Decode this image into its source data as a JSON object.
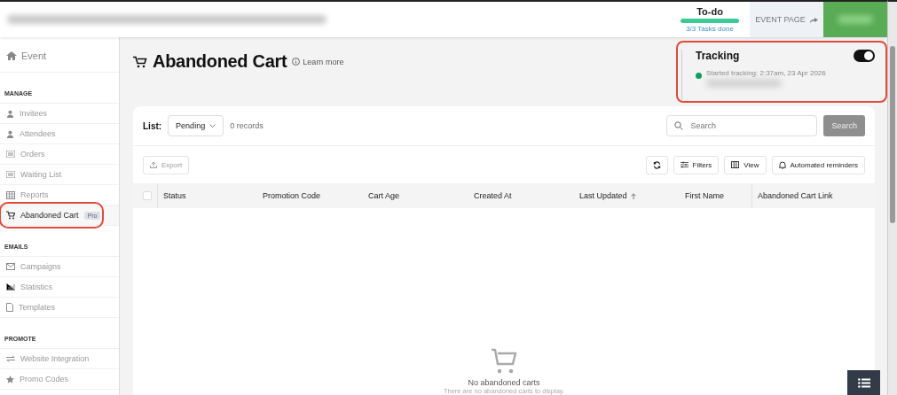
{
  "topbar": {
    "todo": {
      "label": "To-do",
      "level": 1,
      "caption": "3/3 Tasks done"
    },
    "event_page": "EVENT PAGE"
  },
  "sidebar": {
    "home": "Event",
    "sections": [
      {
        "title": "MANAGE",
        "items": [
          {
            "label": "Invitees",
            "kind": "person",
            "selected": false
          },
          {
            "label": "Attendees",
            "kind": "person",
            "selected": false
          },
          {
            "label": "Orders",
            "kind": "list",
            "selected": false
          },
          {
            "label": "Waiting List",
            "kind": "list",
            "selected": false
          },
          {
            "label": "Reports",
            "kind": "grid",
            "selected": false
          },
          {
            "label": "Abandoned Cart",
            "kind": "cart",
            "selected": true,
            "badge": "Pro",
            "highlighted": true
          }
        ]
      },
      {
        "title": "EMAILS",
        "items": [
          {
            "label": "Campaigns",
            "kind": "mail",
            "selected": false
          },
          {
            "label": "Statistics",
            "kind": "chart",
            "selected": false
          },
          {
            "label": "Templates",
            "kind": "page",
            "selected": false
          }
        ]
      },
      {
        "title": "PROMOTE",
        "items": [
          {
            "label": "Website Integration",
            "kind": "arrows",
            "selected": false
          },
          {
            "label": "Promo Codes",
            "kind": "star",
            "selected": false
          }
        ]
      }
    ]
  },
  "page": {
    "title": "Abandoned Cart",
    "learn_more": "Learn more"
  },
  "tracking": {
    "title": "Tracking",
    "on": true,
    "status": "Started tracking: 2:37am, 23 Apr 2026",
    "color": "#0f9d58",
    "highlighted": true
  },
  "list": {
    "label": "List:",
    "value": "Pending",
    "records": "0 records",
    "search_placeholder": "Search",
    "search_button": "Search"
  },
  "toolbar": {
    "export": "Export",
    "filters": "Filters",
    "view": "View",
    "reminders": "Automated reminders"
  },
  "table": {
    "select_all": {
      "checked": false
    },
    "columns": [
      {
        "label": "Status",
        "sorted": false
      },
      {
        "label": "Promotion Code",
        "sorted": false
      },
      {
        "label": "Cart Age",
        "sorted": false
      },
      {
        "label": "Created At",
        "sorted": false
      },
      {
        "label": "Last Updated",
        "sorted": true
      },
      {
        "label": "First Name",
        "sorted": false
      },
      {
        "label": "Abandoned Cart Link",
        "sorted": false
      }
    ]
  },
  "empty": {
    "title": "No abandoned carts",
    "text": "There are no abandoned carts to display."
  }
}
